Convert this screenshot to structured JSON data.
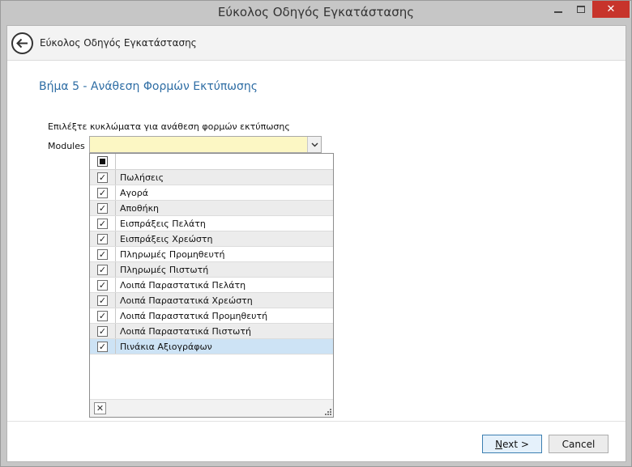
{
  "window": {
    "title": "Εύκολος Οδηγός Εγκατάστασης",
    "close_glyph": "✕"
  },
  "header": {
    "title": "Εύκολος Οδηγός Εγκατάστασης"
  },
  "step": {
    "title": "Βήμα 5 - Ανάθεση Φορμών Εκτύπωσης"
  },
  "form": {
    "instruction": "Επιλέξτε κυκλώματα για ανάθεση φορμών εκτύπωσης",
    "modules_label": "Modules",
    "combo_value": ""
  },
  "dropdown": {
    "items": [
      {
        "label": "Πωλήσεις",
        "checked": true
      },
      {
        "label": "Αγορά",
        "checked": true
      },
      {
        "label": "Αποθήκη",
        "checked": true
      },
      {
        "label": "Εισπράξεις Πελάτη",
        "checked": true
      },
      {
        "label": "Εισπράξεις Χρεώστη",
        "checked": true
      },
      {
        "label": "Πληρωμές Προμηθευτή",
        "checked": true
      },
      {
        "label": "Πληρωμές Πιστωτή",
        "checked": true
      },
      {
        "label": "Λοιπά Παραστατικά Πελάτη",
        "checked": true
      },
      {
        "label": "Λοιπά Παραστατικά Χρεώστη",
        "checked": true
      },
      {
        "label": "Λοιπά Παραστατικά Προμηθευτή",
        "checked": true
      },
      {
        "label": "Λοιπά Παραστατικά Πιστωτή",
        "checked": true
      },
      {
        "label": "Πινάκια Αξιογράφων",
        "checked": true,
        "selected": true
      }
    ],
    "check_glyph": "✓",
    "clear_glyph": "✕"
  },
  "buttons": {
    "next_mnemonic": "N",
    "next_rest": "ext >",
    "cancel": "Cancel"
  },
  "colors": {
    "accent": "#2e6da4",
    "combo_bg": "#fcf7c4",
    "selection": "#cde3f5",
    "close": "#c7342b"
  }
}
